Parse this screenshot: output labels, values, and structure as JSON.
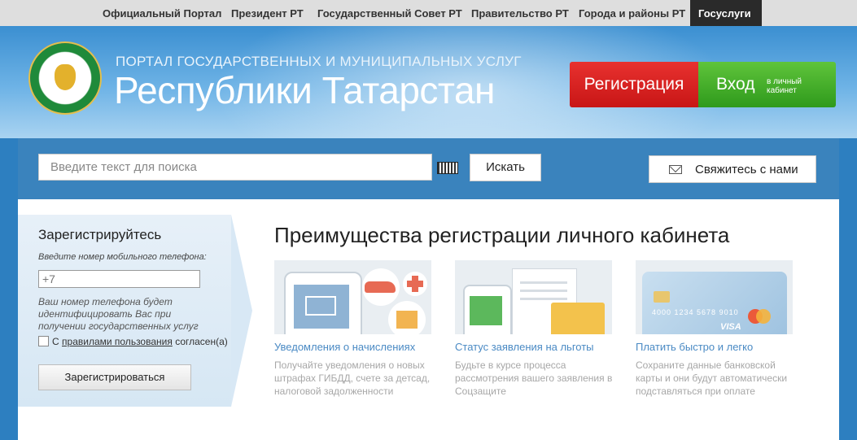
{
  "topnav": {
    "items": [
      {
        "label": "Официальный Портал"
      },
      {
        "label": "Президент РТ"
      },
      {
        "label": "Государственный Совет РТ"
      },
      {
        "label": "Правительство РТ"
      },
      {
        "label": "Города и районы РТ"
      },
      {
        "label": "Госуслуги"
      }
    ],
    "active": "Госуслуги"
  },
  "header": {
    "subtitle": "ПОРТАЛ ГОСУДАРСТВЕННЫХ И МУНИЦИПАЛЬНЫХ УСЛУГ",
    "title": "Республики Татарстан",
    "register_label": "Регистрация",
    "login_label": "Вход",
    "login_sub": "в личный кабинет"
  },
  "search": {
    "placeholder": "Введите текст для поиска",
    "button_label": "Искать",
    "contact_label": "Свяжитесь с нами"
  },
  "register_form": {
    "title": "Зарегистрируйтесь",
    "phone_hint": "Введите номер мобильного телефона:",
    "phone_value": "+7",
    "note": "Ваш номер телефона будет идентифицировать Вас при получении государственных услуг",
    "agree_prefix": "С",
    "agree_link": "правилами пользования",
    "agree_suffix": "согласен(а)",
    "submit_label": "Зарегистрироваться"
  },
  "benefits": {
    "title": "Преимущества регистрации личного кабинета",
    "cards": [
      {
        "title": "Уведомления о начислениях",
        "description": "Получайте уведомления о новых штрафах ГИБДД, счете за детсад, налоговой задолженности"
      },
      {
        "title": "Статус заявления на льготы",
        "description": "Будьте в курсе процесса рассмотрения вашего заявления в Соцзащите"
      },
      {
        "title": "Платить быстро и легко",
        "description": "Сохраните данные банковской карты и они будут автоматически подставляться при оплате"
      }
    ],
    "card_number": "4000 1234 5678 9010",
    "card_brand": "VISA"
  },
  "colors": {
    "register": "#d91f22",
    "login": "#45ad2a",
    "link": "#4a8ac4",
    "searchbar": "#3a83bd"
  }
}
